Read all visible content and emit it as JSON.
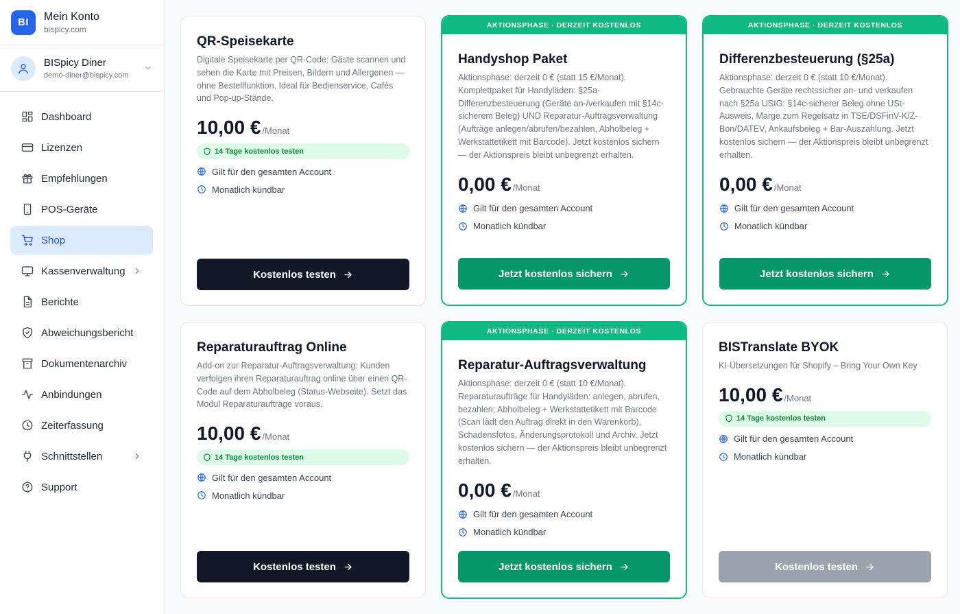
{
  "account": {
    "logo": "BI",
    "title": "Mein Konto",
    "domain": "bispicy.com"
  },
  "user": {
    "name": "BISpicy Diner",
    "email": "demo-diner@bispicy.com"
  },
  "nav": [
    {
      "label": "Dashboard",
      "icon": "grid-icon"
    },
    {
      "label": "Lizenzen",
      "icon": "card-icon"
    },
    {
      "label": "Empfehlungen",
      "icon": "gift-icon"
    },
    {
      "label": "POS-Geräte",
      "icon": "device-icon"
    },
    {
      "label": "Shop",
      "icon": "cart-icon",
      "active": true
    },
    {
      "label": "Kassenverwaltung",
      "icon": "monitor-icon",
      "chevron": true
    },
    {
      "label": "Berichte",
      "icon": "document-icon"
    },
    {
      "label": "Abweichungsbericht",
      "icon": "shield-icon"
    },
    {
      "label": "Dokumentenarchiv",
      "icon": "archive-icon"
    },
    {
      "label": "Anbindungen",
      "icon": "activity-icon"
    },
    {
      "label": "Zeiterfassung",
      "icon": "clock-icon"
    },
    {
      "label": "Schnittstellen",
      "icon": "plug-icon",
      "chevron": true
    },
    {
      "label": "Support",
      "icon": "help-icon"
    }
  ],
  "common": {
    "ribbon": "AKTIONSPHASE · DERZEIT KOSTENLOS",
    "per_month": "/Monat",
    "trial": "14 Tage kostenlos testen",
    "feature_account": "Gilt für den gesamten Account",
    "feature_cancel": "Monatlich kündbar"
  },
  "cards": [
    {
      "title": "QR-Speisekarte",
      "desc": "Digitale Speisekarte per QR-Code: Gäste scannen und sehen die Karte mit Preisen, Bildern und Allergenen — ohne Bestellfunktion. Ideal für Bedienservice, Cafés und Pop-up-Stände.",
      "price": "10,00 €",
      "button": "Kostenlos testen"
    },
    {
      "title": "Handyshop Paket",
      "desc": "Aktionsphase: derzeit 0 € (statt 15 €/Monat). Komplettpaket für Handyläden: §25a-Differenzbesteuerung (Geräte an-/verkaufen mit §14c-sicherem Beleg) UND Reparatur-Auftragsverwaltung (Aufträge anlegen/abrufen/bezahlen, Abholbeleg + Werkstatt­etikett mit Barcode). Jetzt kostenlos sichern — der Aktionspreis bleibt unbegrenzt erhalten.",
      "price": "0,00 €",
      "button": "Jetzt kostenlos sichern"
    },
    {
      "title": "Differenzbesteuerung (§25a)",
      "desc": "Aktionsphase: derzeit 0 € (statt 10 €/Monat). Gebrauchte Geräte rechtssicher an- und verkaufen nach §25a UStG: §14c-sicherer Beleg ohne USt-Ausweis, Marge zum Regelsatz in TSE/DSFinV-K/Z-Bon/DATEV, Ankaufsbeleg + Bar-Auszahlung. Jetzt kostenlos sichern — der Aktionspreis bleibt unbegrenzt erhalten.",
      "price": "0,00 €",
      "button": "Jetzt kostenlos sichern"
    },
    {
      "title": "Reparaturauftrag Online",
      "desc": "Add-on zur Reparatur-Auftragsverwaltung: Kunden verfolgen ihren Reparaturauftrag online über einen QR-Code auf dem Abholbeleg (Status-Webseite). Setzt das Modul Reparaturaufträge voraus.",
      "price": "10,00 €",
      "button": "Kostenlos testen"
    },
    {
      "title": "Reparatur-Auftragsverwaltung",
      "desc": "Aktionsphase: derzeit 0 € (statt 10 €/Monat). Reparaturaufträge für Handyläden: anlegen, abrufen, bezahlen; Abholbeleg + Werkstatt­etikett mit Barcode (Scan lädt den Auftrag direkt in den Warenkorb), Schadensfotos, Änderungsprotokoll und Archiv. Jetzt kostenlos sichern — der Aktionspreis bleibt unbegrenzt erhalten.",
      "price": "0,00 €",
      "button": "Jetzt kostenlos sichern"
    },
    {
      "title": "BISTranslate BYOK",
      "desc": "KI-Übersetzungen für Shopify – Bring Your Own Key",
      "price": "10,00 €",
      "button": "Kostenlos testen"
    }
  ]
}
